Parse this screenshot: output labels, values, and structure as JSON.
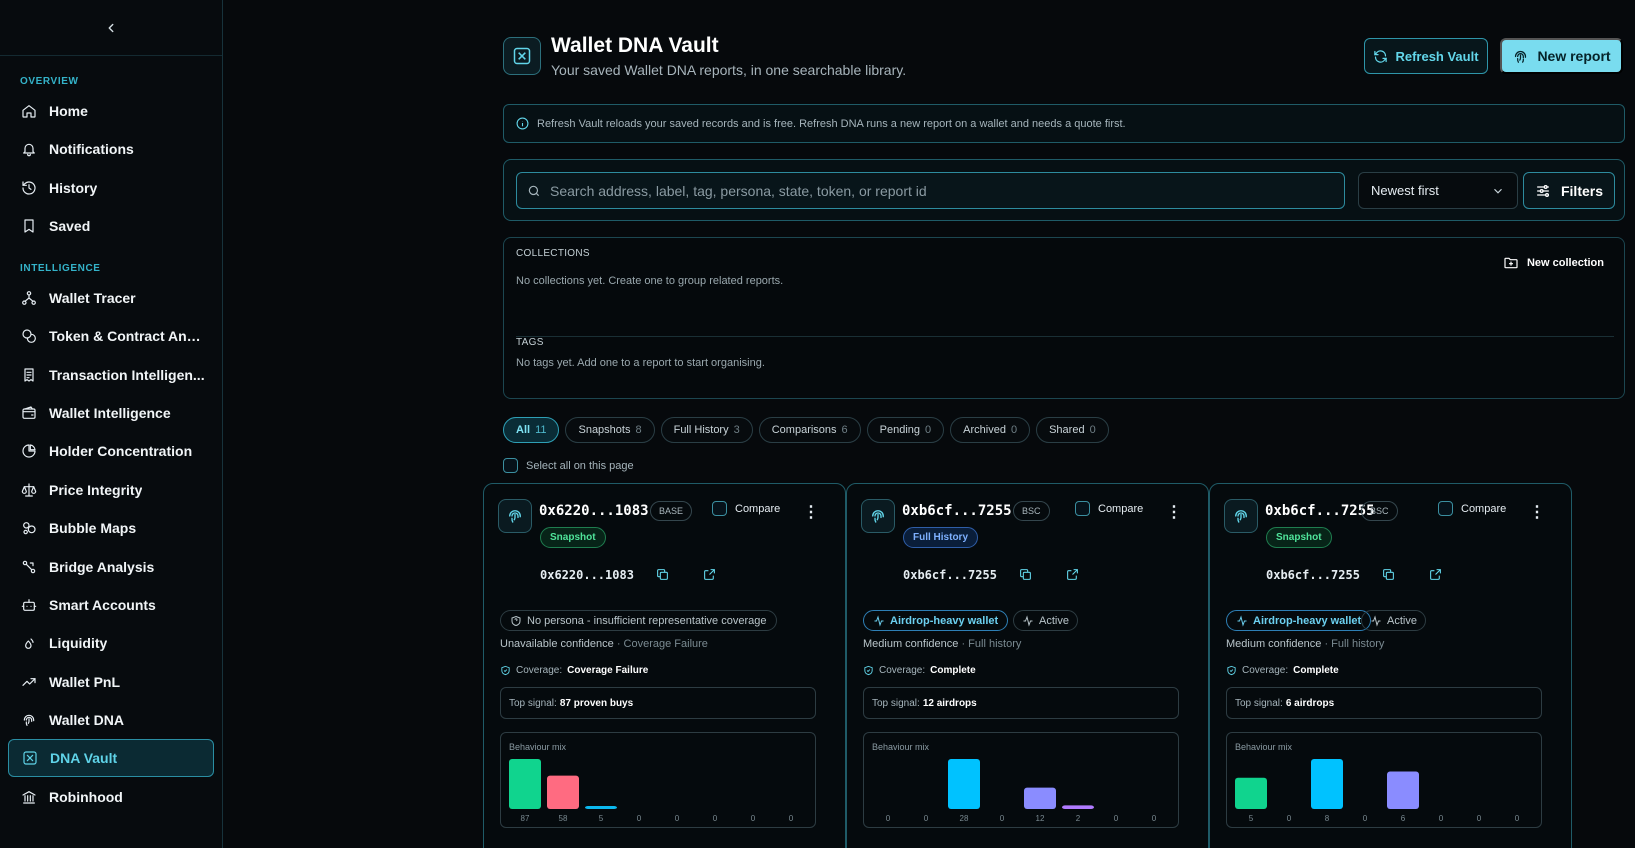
{
  "sidebar": {
    "sections": [
      {
        "label": "OVERVIEW"
      },
      {
        "label": "INTELLIGENCE"
      }
    ],
    "items": [
      {
        "label": "Home",
        "icon": "home-icon"
      },
      {
        "label": "Notifications",
        "icon": "bell-icon"
      },
      {
        "label": "History",
        "icon": "history-icon"
      },
      {
        "label": "Saved",
        "icon": "bookmark-icon"
      },
      {
        "label": "Wallet Tracer",
        "icon": "network-icon"
      },
      {
        "label": "Token & Contract Anal...",
        "icon": "coins-icon"
      },
      {
        "label": "Transaction Intelligen...",
        "icon": "receipt-icon"
      },
      {
        "label": "Wallet Intelligence",
        "icon": "wallet-icon"
      },
      {
        "label": "Holder Concentration",
        "icon": "pie-chart-icon"
      },
      {
        "label": "Price Integrity",
        "icon": "scale-icon"
      },
      {
        "label": "Bubble Maps",
        "icon": "bubbles-icon"
      },
      {
        "label": "Bridge Analysis",
        "icon": "bridge-icon"
      },
      {
        "label": "Smart Accounts",
        "icon": "robot-icon"
      },
      {
        "label": "Liquidity",
        "icon": "droplets-icon"
      },
      {
        "label": "Wallet PnL",
        "icon": "trending-up-icon"
      },
      {
        "label": "Wallet DNA",
        "icon": "fingerprint-icon"
      },
      {
        "label": "DNA Vault",
        "icon": "vault-icon",
        "active": true
      },
      {
        "label": "Robinhood",
        "icon": "bank-icon"
      }
    ]
  },
  "header": {
    "title": "Wallet DNA Vault",
    "subtitle": "Your saved Wallet DNA reports, in one searchable library.",
    "refresh_label": "Refresh Vault",
    "new_report_label": "New report"
  },
  "info": {
    "text": "Refresh Vault reloads your saved records and is free. Refresh DNA runs a new report on a wallet and needs a quote first."
  },
  "search": {
    "placeholder": "Search address, label, tag, persona, state, token, or report id",
    "value": "",
    "sort_value": "Newest first",
    "filters_label": "Filters"
  },
  "collections": {
    "title": "COLLECTIONS",
    "empty": "No collections yet. Create one to group related reports.",
    "new_label": "New collection",
    "tags_title": "TAGS",
    "tags_empty": "No tags yet. Add one to a report to start organising."
  },
  "tabs": [
    {
      "label": "All",
      "count": "11",
      "active": true
    },
    {
      "label": "Snapshots",
      "count": "8"
    },
    {
      "label": "Full History",
      "count": "3"
    },
    {
      "label": "Comparisons",
      "count": "6"
    },
    {
      "label": "Pending",
      "count": "0"
    },
    {
      "label": "Archived",
      "count": "0"
    },
    {
      "label": "Shared",
      "count": "0"
    }
  ],
  "select_all_label": "Select all on this page",
  "compare_label": "Compare",
  "coverage_prefix": "Coverage:",
  "signal_prefix": "Top signal:",
  "mix_title": "Behaviour mix",
  "colors": {
    "accent": "#62d6ea",
    "bars": [
      "#10d48e",
      "#ff6b81",
      "#0bb8ee",
      "#ffa34d",
      "#00c8ff",
      "#8b5cf6",
      "#7b83ff",
      "#9b7bff"
    ]
  },
  "cards": [
    {
      "address": "0x6220...1083",
      "chain": "BASE",
      "kind": "Snapshot",
      "kind_style": "snapshot",
      "persona": "No persona - insufficient representative coverage",
      "persona_highlight": false,
      "state": "",
      "confidence": "Unavailable confidence",
      "confidence_sub": "· Coverage Failure",
      "coverage": "Coverage Failure",
      "signal": "87 proven buys",
      "mix": [
        87,
        58,
        5,
        0,
        0,
        0,
        0,
        0
      ],
      "mix_colors": [
        "#10d48e",
        "#ff6b81",
        "#0bb8ee",
        "#ffa34d",
        "#00c8ff",
        "#8b5cf6",
        "#7b83ff",
        "#9b7bff"
      ]
    },
    {
      "address": "0xb6cf...7255",
      "chain": "BSC",
      "kind": "Full History",
      "kind_style": "full",
      "persona": "Airdrop-heavy wallet",
      "persona_highlight": true,
      "state": "Active",
      "confidence": "Medium confidence",
      "confidence_sub": "· Full history",
      "coverage": "Complete",
      "signal": "12 airdrops",
      "mix": [
        0,
        0,
        28,
        0,
        12,
        2,
        0,
        0
      ],
      "mix_colors": [
        "#10d48e",
        "#ff6b81",
        "#00c2ff",
        "#ffa34d",
        "#8a8cff",
        "#b07bff",
        "#7b83ff",
        "#9b7bff"
      ]
    },
    {
      "address": "0xb6cf...7255",
      "chain": "BSC",
      "kind": "Snapshot",
      "kind_style": "snapshot",
      "persona": "Airdrop-heavy wallet",
      "persona_highlight": true,
      "state": "Active",
      "confidence": "Medium confidence",
      "confidence_sub": "· Full history",
      "coverage": "Complete",
      "signal": "6 airdrops",
      "mix": [
        5,
        0,
        8,
        0,
        6,
        0,
        0,
        0
      ],
      "mix_colors": [
        "#10d48e",
        "#ff6b81",
        "#00c2ff",
        "#ffa34d",
        "#8a8cff",
        "#b07bff",
        "#7b83ff",
        "#9b7bff"
      ]
    }
  ]
}
